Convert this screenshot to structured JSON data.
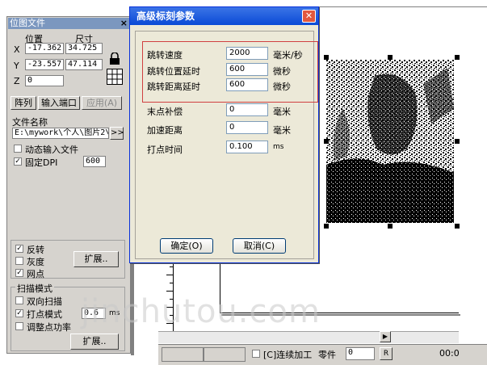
{
  "panel": {
    "title": "位图文件",
    "close": "×",
    "col_pos": "位置",
    "col_size": "尺寸",
    "x_label": "X",
    "x_pos": "-17.362",
    "x_size": "34.725",
    "y_label": "Y",
    "y_pos": "-23.557",
    "y_size": "47.114",
    "z_label": "Z",
    "z_val": "0",
    "btn_array": "阵列",
    "btn_input_port": "输入端口",
    "btn_apply": "应用(A)",
    "filename_label": "文件名称",
    "filename_value": "E:\\mywork\\个人\\图片2\\",
    "filename_btn": ">>",
    "dynamic_input": "动态输入文件",
    "fixed_dpi": "固定DPI",
    "dpi_value": "600",
    "invert": "反转",
    "grayscale": "灰度",
    "dots": "网点",
    "expand1": "扩展..",
    "scan_mode": "扫描模式",
    "bidirectional": "双向扫描",
    "dot_mode": "打点模式",
    "dot_mode_val": "0.6",
    "dot_mode_unit": "ms",
    "adjust_power": "调整点功率",
    "expand2": "扩展.."
  },
  "dialog": {
    "title": "高级标刻参数",
    "close": "✕",
    "rows": [
      {
        "label": "跳转速度",
        "value": "2000",
        "unit": "毫米/秒"
      },
      {
        "label": "跳转位置延时",
        "value": "600",
        "unit": "微秒"
      },
      {
        "label": "跳转距离延时",
        "value": "600",
        "unit": "微秒"
      },
      {
        "label": "末点补偿",
        "value": "0",
        "unit": "毫米"
      },
      {
        "label": "加速距离",
        "value": "0",
        "unit": "毫米"
      },
      {
        "label": "打点时间",
        "value": "0.100",
        "unit": "ms"
      }
    ],
    "ok": "确定(O)",
    "cancel": "取消(C)"
  },
  "statusbar": {
    "continuous": "[C]连续加工",
    "parts": "零件",
    "parts_val": "0",
    "r_btn": "R",
    "time": "00:0"
  },
  "watermark": "jinchutou.com"
}
